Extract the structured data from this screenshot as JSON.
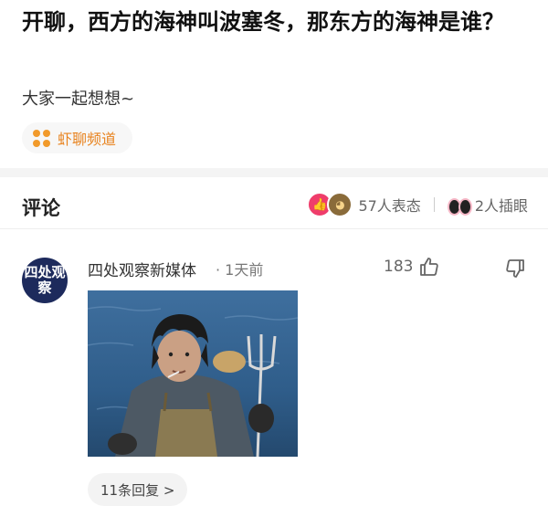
{
  "post": {
    "title": "开聊，西方的海神叫波塞冬，那东方的海神是谁？",
    "subtitle": "大家一起想想~",
    "channel": "虾聊频道"
  },
  "comments_section": {
    "header": "评论",
    "reactions_text": "57人表态",
    "watching_text": "2人插眼"
  },
  "comment": {
    "avatar_text": "四处观察",
    "author": "四处观察新媒体",
    "time": "· 1天前",
    "likes": "183",
    "replies": "11条回复 >"
  },
  "colors": {
    "accent": "#e8831f",
    "like_badge": "#ef3d6b",
    "avatar_bg": "#1d2a5c"
  },
  "icons": [
    "dots-icon",
    "like-reaction-icon",
    "face-reaction-icon",
    "eyes-icon",
    "thumb-up-icon",
    "thumb-down-icon"
  ]
}
